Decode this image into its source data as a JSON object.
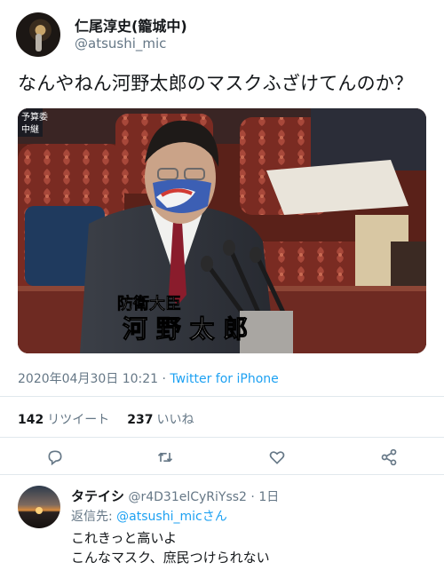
{
  "tweet": {
    "display_name": "仁尾淳史(籠城中)",
    "handle": "@atsushi_mic",
    "text": "なんやねん河野太郎のマスクふざけてんのか？",
    "media": {
      "corner_label_top": "予算委",
      "corner_label_bottom": "中継",
      "caption_title": "防衛大臣",
      "caption_name": "河 野 太 郎"
    },
    "timestamp": "2020年04月30日 10:21",
    "separator": " · ",
    "source": "Twitter for iPhone",
    "retweet_count": "142",
    "retweet_label": "リツイート",
    "like_count": "237",
    "like_label": "いいね"
  },
  "actions": [
    "reply-icon",
    "retweet-icon",
    "like-icon",
    "share-icon"
  ],
  "reply": {
    "name": "タテイシ",
    "handle": "@r4D31elCyRiYss2",
    "separator": " · ",
    "time": "1日",
    "reply_to_prefix": "返信先: ",
    "reply_to_handle": "@atsushi_micさん",
    "lines": [
      "これきっと高いよ",
      "こんなマスク、庶民つけられない"
    ]
  },
  "colors": {
    "accent": "#1da1f2",
    "muted": "#657786",
    "divider": "#e1e8ed",
    "text": "#14171a"
  }
}
